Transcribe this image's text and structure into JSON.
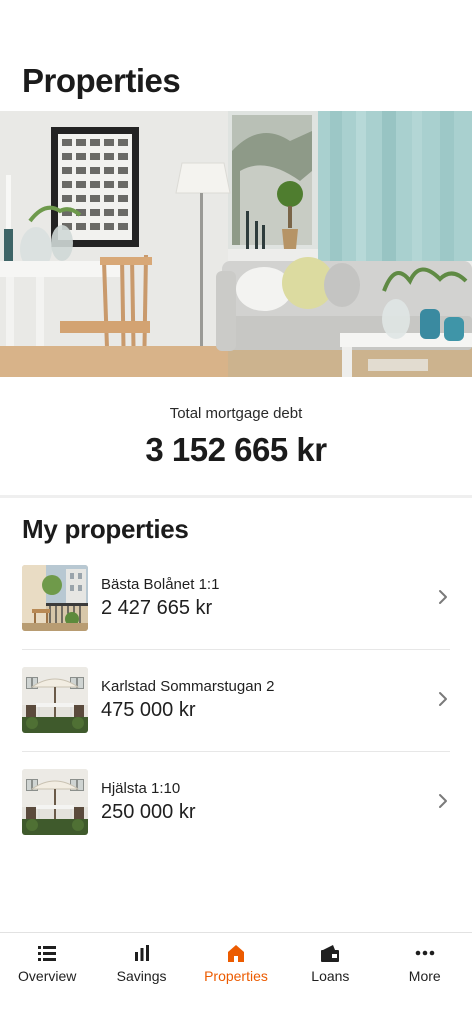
{
  "header": {
    "title": "Properties"
  },
  "summary": {
    "label": "Total mortgage debt",
    "amount": "3 152 665 kr"
  },
  "properties_section": {
    "title": "My properties",
    "items": [
      {
        "name": "Bästa Bolånet 1:1",
        "value": "2 427 665 kr",
        "thumbnail": "balcony-photo"
      },
      {
        "name": "Karlstad Sommarstugan 2",
        "value": "475 000 kr",
        "thumbnail": "patio-umbrella-photo"
      },
      {
        "name": "Hjälsta 1:10",
        "value": "250 000 kr",
        "thumbnail": "patio-umbrella-photo"
      }
    ]
  },
  "tab_bar": {
    "active_color": "#ec5b00",
    "tabs": [
      {
        "label": "Overview",
        "icon": "list-icon",
        "active": false
      },
      {
        "label": "Savings",
        "icon": "bar-chart-icon",
        "active": false
      },
      {
        "label": "Properties",
        "icon": "house-icon",
        "active": true
      },
      {
        "label": "Loans",
        "icon": "wallet-icon",
        "active": false
      },
      {
        "label": "More",
        "icon": "more-dots-icon",
        "active": false
      }
    ]
  }
}
